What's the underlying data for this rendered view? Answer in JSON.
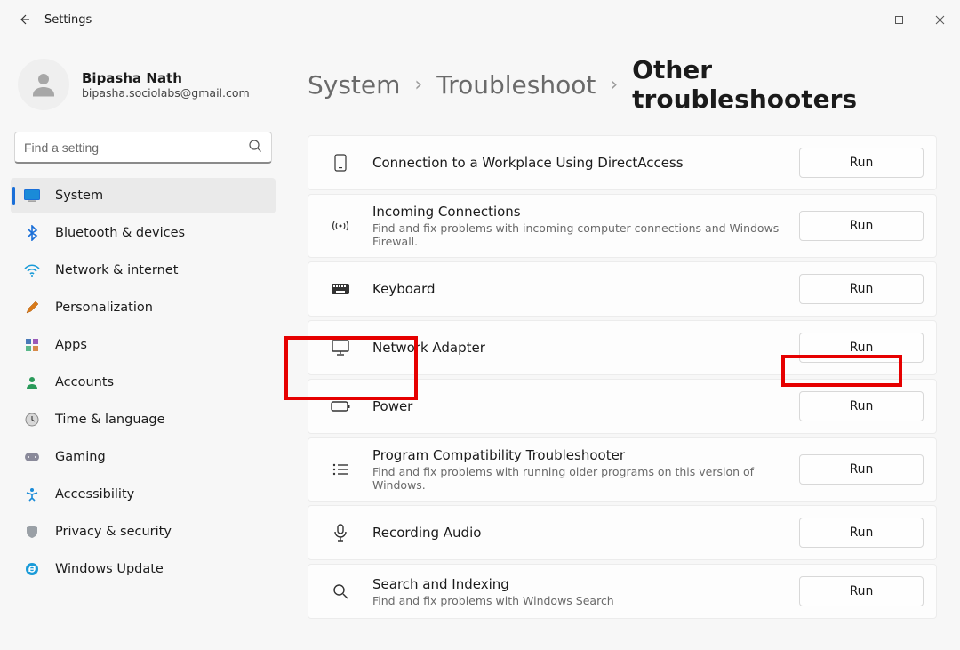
{
  "window": {
    "title": "Settings"
  },
  "profile": {
    "name": "Bipasha Nath",
    "email": "bipasha.sociolabs@gmail.com"
  },
  "search": {
    "placeholder": "Find a setting"
  },
  "sidebar": {
    "items": [
      {
        "label": "System"
      },
      {
        "label": "Bluetooth & devices"
      },
      {
        "label": "Network & internet"
      },
      {
        "label": "Personalization"
      },
      {
        "label": "Apps"
      },
      {
        "label": "Accounts"
      },
      {
        "label": "Time & language"
      },
      {
        "label": "Gaming"
      },
      {
        "label": "Accessibility"
      },
      {
        "label": "Privacy & security"
      },
      {
        "label": "Windows Update"
      }
    ]
  },
  "breadcrumb": {
    "root": "System",
    "mid": "Troubleshoot",
    "current": "Other troubleshooters"
  },
  "run_label": "Run",
  "troubleshooters": [
    {
      "title": "Connection to a Workplace Using DirectAccess",
      "subtitle": ""
    },
    {
      "title": "Incoming Connections",
      "subtitle": "Find and fix problems with incoming computer connections and Windows Firewall."
    },
    {
      "title": "Keyboard",
      "subtitle": ""
    },
    {
      "title": "Network Adapter",
      "subtitle": ""
    },
    {
      "title": "Power",
      "subtitle": ""
    },
    {
      "title": "Program Compatibility Troubleshooter",
      "subtitle": "Find and fix problems with running older programs on this version of Windows."
    },
    {
      "title": "Recording Audio",
      "subtitle": ""
    },
    {
      "title": "Search and Indexing",
      "subtitle": "Find and fix problems with Windows Search"
    }
  ]
}
